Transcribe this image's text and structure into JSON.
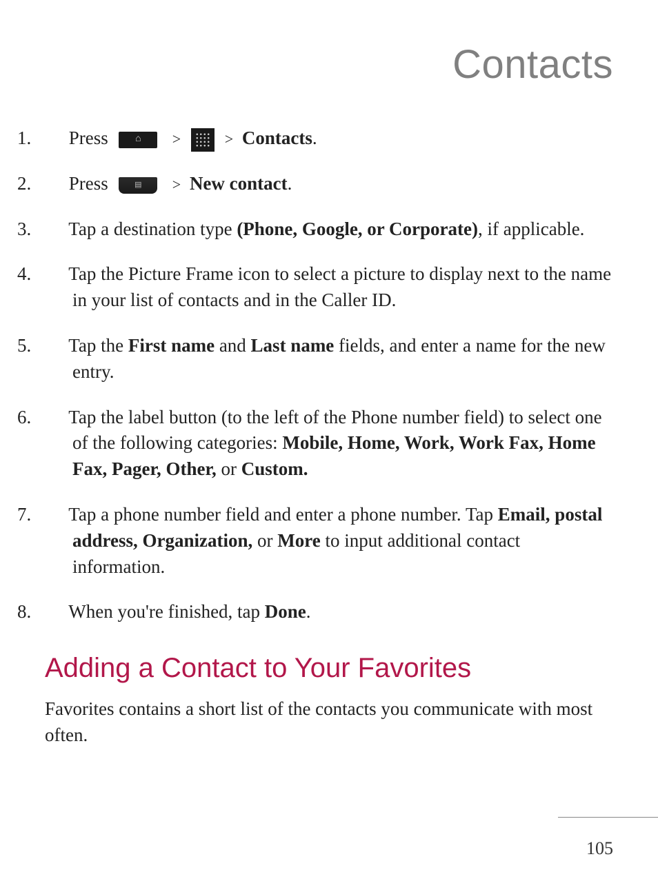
{
  "page_title": "Contacts",
  "steps": {
    "s1_prefix": "1.",
    "s1_press": "Press",
    "s1_contacts": "Contacts",
    "s2_prefix": "2.",
    "s2_press": "Press",
    "s2_newcontact": "New contact",
    "s3_prefix": "3.",
    "s3_a": "Tap a destination type ",
    "s3_bold": "(Phone, Google, or Corporate)",
    "s3_b": ", if applicable.",
    "s4_prefix": "4.",
    "s4_text": "Tap the Picture Frame icon to select a picture to display next to the name in your list of contacts and in the Caller ID.",
    "s5_prefix": "5.",
    "s5_a": "Tap the ",
    "s5_first": "First name",
    "s5_and": " and ",
    "s5_last": "Last name",
    "s5_b": " fields, and enter a name for the new entry.",
    "s6_prefix": "6.",
    "s6_a": "Tap the label button (to the left of the Phone number field) to select one of the following categories: ",
    "s6_bold": "Mobile, Home, Work, Work Fax, Home Fax, Pager, Other,",
    "s6_or": " or ",
    "s6_custom": "Custom.",
    "s7_prefix": "7.",
    "s7_a": "Tap a phone number field and enter a phone number. Tap ",
    "s7_bold1": "Email, postal address, Organization,",
    "s7_or": " or ",
    "s7_bold2": "More",
    "s7_b": " to input additional contact information.",
    "s8_prefix": "8.",
    "s8_a": "When you're finished, tap ",
    "s8_done": "Done",
    "s8_b": "."
  },
  "section_heading": "Adding a Contact to Your Favorites",
  "section_body": "Favorites contains a short list of the contacts you communicate with most often.",
  "page_number": "105",
  "gt": ">",
  "period": "."
}
